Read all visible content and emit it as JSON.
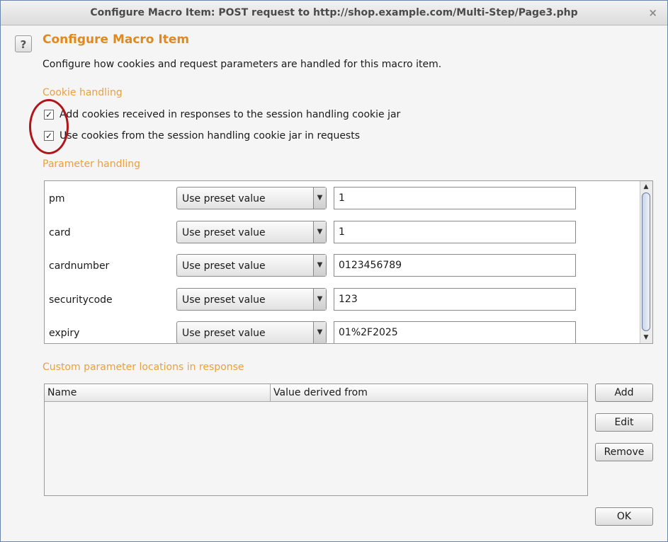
{
  "window": {
    "title": "Configure Macro Item: POST request to http://shop.example.com/Multi-Step/Page3.php",
    "close_glyph": "×",
    "help_glyph": "?"
  },
  "header": {
    "heading": "Configure Macro Item",
    "description": "Configure how cookies and request parameters are handled for this macro item."
  },
  "cookie_handling": {
    "label": "Cookie handling",
    "options": [
      {
        "label": "Add cookies received in responses to the session handling cookie jar",
        "checked": true
      },
      {
        "label": "Use cookies from the session handling cookie jar in requests",
        "checked": true
      }
    ],
    "check_glyph": "✓"
  },
  "parameter_handling": {
    "label": "Parameter handling",
    "rows": [
      {
        "name": "pm",
        "mode": "Use preset value",
        "value": "1"
      },
      {
        "name": "card",
        "mode": "Use preset value",
        "value": "1"
      },
      {
        "name": "cardnumber",
        "mode": "Use preset value",
        "value": "0123456789"
      },
      {
        "name": "securitycode",
        "mode": "Use preset value",
        "value": "123"
      },
      {
        "name": "expiry",
        "mode": "Use preset value",
        "value": "01%2F2025"
      }
    ],
    "dropdown_glyph": "▼",
    "scroll_up_glyph": "▲",
    "scroll_down_glyph": "▼"
  },
  "custom_locations": {
    "label": "Custom parameter locations in response",
    "columns": [
      "Name",
      "Value derived from"
    ],
    "rows": []
  },
  "buttons": {
    "add": "Add",
    "edit": "Edit",
    "remove": "Remove",
    "ok": "OK"
  },
  "colors": {
    "accent_orange": "#e08a1e",
    "annotation_red": "#b0151a",
    "border_blue": "#6b86a8"
  }
}
